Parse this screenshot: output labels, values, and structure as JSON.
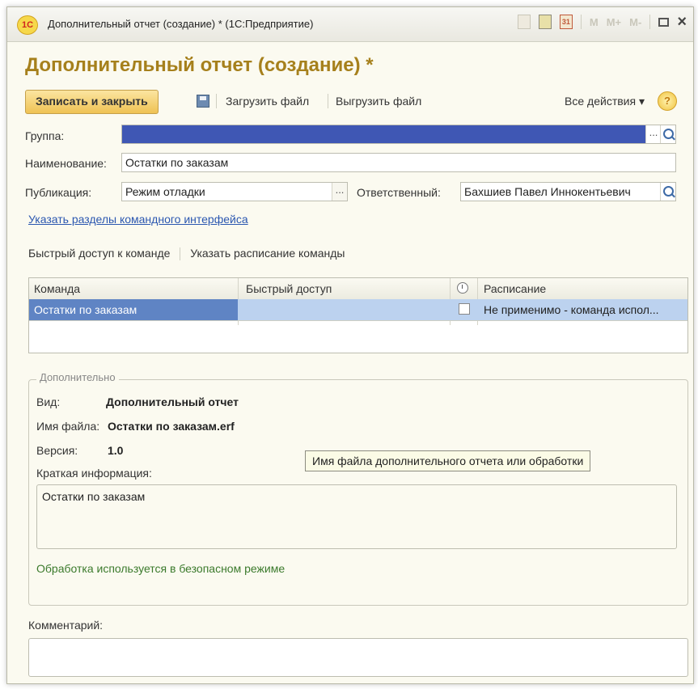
{
  "window": {
    "title": "Дополнительный отчет (создание) * (1С:Предприятие)",
    "logo_text": "1С",
    "tb_icons": {
      "m": "M",
      "m_plus": "M+",
      "m_minus": "M-",
      "calendar_text": "31",
      "close": "×"
    }
  },
  "form": {
    "title": "Дополнительный отчет (создание) *"
  },
  "toolbar": {
    "save_close": "Записать и закрыть",
    "load_file": "Загрузить файл",
    "unload_file": "Выгрузить файл",
    "all_actions": "Все действия ▾",
    "help": "?"
  },
  "fields": {
    "group_label": "Группа:",
    "group_value": "",
    "name_label": "Наименование:",
    "name_value": "Остатки по заказам",
    "publication_label": "Публикация:",
    "publication_value": "Режим отладки",
    "responsible_label": "Ответственный:",
    "responsible_value": "Бахшиев Павел Иннокентьевич",
    "ellipsis": "..."
  },
  "link": "Указать разделы командного интерфейса",
  "tabs": {
    "quick_access": "Быстрый доступ к команде",
    "schedule": "Указать расписание команды"
  },
  "grid": {
    "headers": {
      "command": "Команда",
      "quick_access": "Быстрый доступ",
      "schedule": "Расписание"
    },
    "rows": [
      {
        "command": "Остатки по заказам",
        "quick_access": "",
        "scheduled": false,
        "schedule": "Не применимо - команда испол..."
      }
    ]
  },
  "extra": {
    "group_title": "Дополнительно",
    "kind_label": "Вид:",
    "kind_value": "Дополнительный отчет",
    "file_label": "Имя файла:",
    "file_value": "Остатки по заказам.erf",
    "version_label": "Версия:",
    "version_value": "1.0",
    "tooltip": "Имя файла дополнительного отчета или обработки",
    "info_label": "Краткая информация:",
    "info_value": "Остатки по заказам",
    "safe_mode_note": "Обработка используется в безопасном режиме"
  },
  "comment": {
    "label": "Комментарий:",
    "value": ""
  },
  "colors": {
    "title_accent": "#a6801c",
    "selection": "#3f57b4",
    "row_selected": "#bcd2ef",
    "link": "#2b57b0",
    "note_green": "#3b7a2c"
  }
}
